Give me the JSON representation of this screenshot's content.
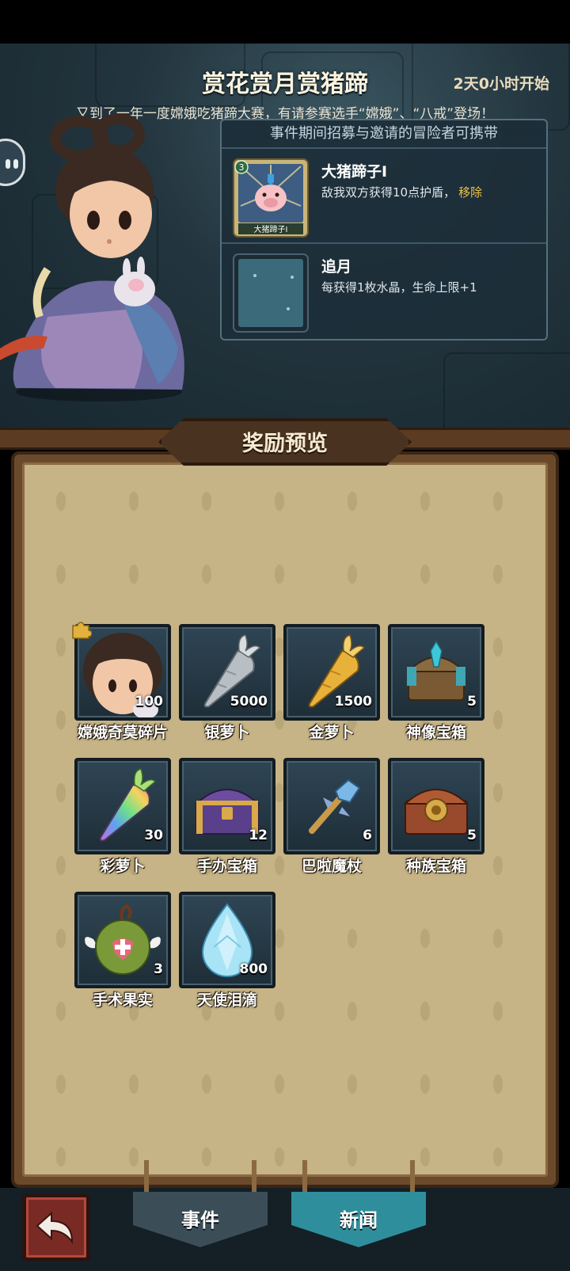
{
  "event": {
    "title": "赏花赏月赏猪蹄",
    "timer": "2天0小时开始",
    "description": "又到了一年一度嫦娥吃猪蹄大赛，有请参赛选手“嫦娥”、“八戒”登场！"
  },
  "perks": {
    "header": "事件期间招募与邀请的冒险者可携带",
    "items": [
      {
        "name": "大猪蹄子Ⅰ",
        "desc": "敌我双方获得10点护盾，",
        "link": "移除",
        "card_label": "大猪蹄子Ⅰ",
        "card_level": "3",
        "icon": "pig-card-icon"
      },
      {
        "name": "追月",
        "desc": "每获得1枚水晶，生命上限+1",
        "icon": "crescent-moon-icon"
      }
    ]
  },
  "rewards": {
    "title": "奖励预览",
    "items": [
      {
        "label": "嫦娥奇莫碎片",
        "count": "100",
        "icon": "change-shard-icon"
      },
      {
        "label": "银萝卜",
        "count": "5000",
        "icon": "silver-carrot-icon"
      },
      {
        "label": "金萝卜",
        "count": "1500",
        "icon": "gold-carrot-icon"
      },
      {
        "label": "神像宝箱",
        "count": "5",
        "icon": "idol-chest-icon"
      },
      {
        "label": "彩萝卜",
        "count": "30",
        "icon": "rainbow-carrot-icon"
      },
      {
        "label": "手办宝箱",
        "count": "12",
        "icon": "figure-chest-icon"
      },
      {
        "label": "巴啦魔杖",
        "count": "6",
        "icon": "magic-wand-icon"
      },
      {
        "label": "种族宝箱",
        "count": "5",
        "icon": "race-chest-icon"
      },
      {
        "label": "手术果实",
        "count": "3",
        "icon": "surgery-fruit-icon"
      },
      {
        "label": "天使泪滴",
        "count": "800",
        "icon": "angel-tear-icon"
      }
    ]
  },
  "nav": {
    "event_label": "事件",
    "news_label": "新闻"
  },
  "colors": {
    "accent_link": "#f0c14a",
    "news_button": "#2f8e9c",
    "event_button": "#3b4e58",
    "back_button": "#7a2a24"
  }
}
